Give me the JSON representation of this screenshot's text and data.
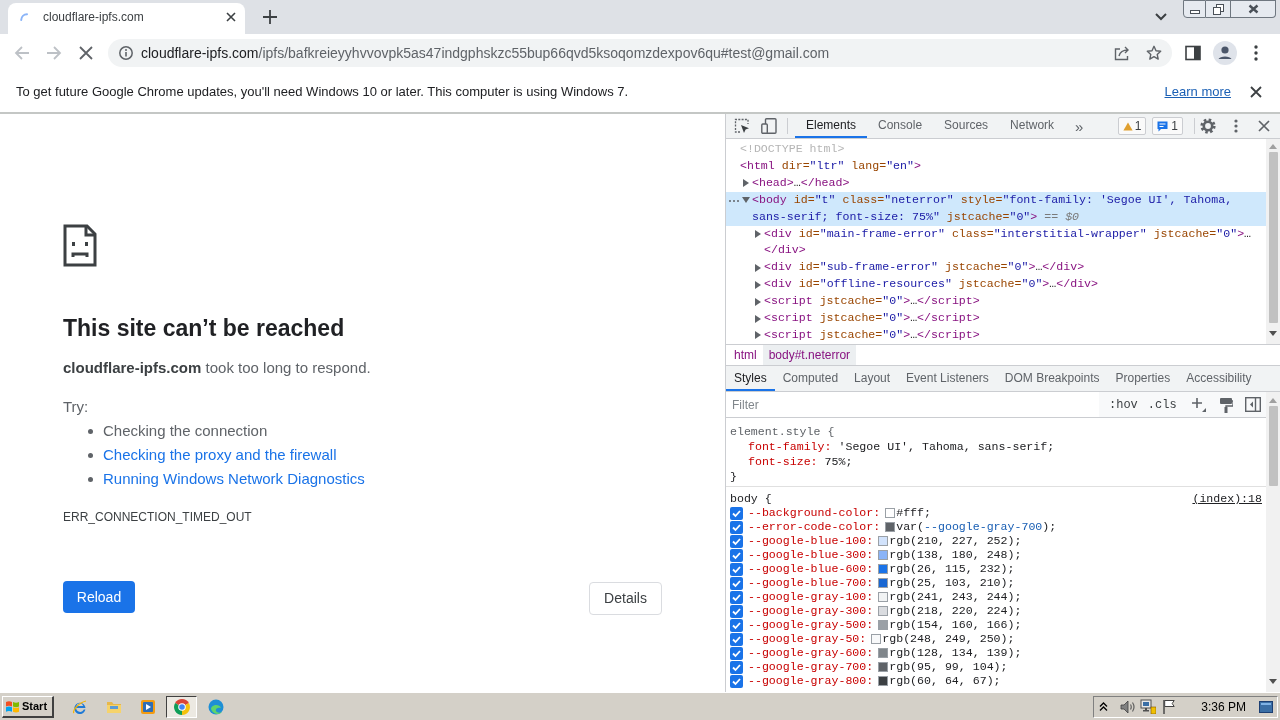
{
  "browser_tabs": [
    {
      "title": "cloudflare-ipfs.com",
      "selected": true,
      "loading": true
    }
  ],
  "toolbar": {
    "nav_buttons": [
      {
        "kind": "back",
        "disabled": true
      },
      {
        "kind": "forward",
        "disabled": true
      }
    ],
    "loading": true,
    "url_host": "cloudflare-ipfs.com",
    "url_path": "/ipfs/bafkreieyyhvvovpk5as47indgphskzc55bup66qvd5ksoqomzdexpov6qu#test@gmail.com"
  },
  "infobar": {
    "message": "To get future Google Chrome updates, you'll need Windows 10 or later. This computer is using Windows 7.",
    "link": "Learn more"
  },
  "error_page": {
    "heading": "This site can’t be reached",
    "summary": "**cloudflare-ipfs.com** took too long to respond.",
    "try_label": "Try:",
    "suggestions": [
      {
        "text": "Checking the connection",
        "kind": "plain"
      },
      {
        "text": "Checking the proxy and the firewall",
        "kind": "link"
      },
      {
        "text": "Running Windows Network Diagnostics",
        "kind": "link"
      }
    ],
    "error_code": "ERR_CONNECTION_TIMED_OUT",
    "buttons": [
      {
        "label": "Reload",
        "kind": "primary"
      },
      {
        "label": "Details",
        "kind": "secondary"
      }
    ]
  },
  "devtools": {
    "tabs": [
      {
        "label": "Elements",
        "selected": true
      },
      {
        "label": "Console",
        "selected": false
      },
      {
        "label": "Sources",
        "selected": false
      },
      {
        "label": "Network",
        "selected": false
      }
    ],
    "more_tabs": "»",
    "warnings": "1",
    "messages": "1",
    "dom_tree": [
      {
        "selected": false,
        "segments": [
          {
            "kind": "doctype",
            "text": "<!DOCTYPE html>"
          }
        ]
      },
      {
        "selected": false,
        "segments": [
          {
            "kind": "tag",
            "text": "<html"
          },
          {
            "kind": "attr",
            "text": " dir="
          },
          {
            "kind": "value",
            "text": "\"ltr\""
          },
          {
            "kind": "attr",
            "text": " lang="
          },
          {
            "kind": "value",
            "text": "\"en\""
          },
          {
            "kind": "tag",
            "text": ">"
          }
        ],
        "children": [
          {
            "expanded": false,
            "selected": false,
            "segments": [
              {
                "kind": "tag",
                "text": "<head>"
              },
              {
                "kind": "text",
                "text": "…"
              },
              {
                "kind": "tag",
                "text": "</head>"
              }
            ]
          },
          {
            "expanded": true,
            "selected": true,
            "segments": [
              {
                "kind": "tag",
                "text": "<body"
              },
              {
                "kind": "attr",
                "text": " id="
              },
              {
                "kind": "value",
                "text": "\"t\""
              },
              {
                "kind": "attr",
                "text": " class="
              },
              {
                "kind": "value",
                "text": "\"neterror\""
              },
              {
                "kind": "attr",
                "text": " style="
              },
              {
                "kind": "value",
                "text": "\"font-family: 'Segoe UI', Tahoma, sans-serif; font-size: 75%\""
              },
              {
                "kind": "attr",
                "text": " jstcache="
              },
              {
                "kind": "value",
                "text": "\"0\""
              },
              {
                "kind": "tag",
                "text": ">"
              },
              {
                "kind": "hint",
                "text": " == *$0*"
              }
            ],
            "children": [
              {
                "expanded": false,
                "selected": false,
                "segments": [
                  {
                    "kind": "tag",
                    "text": "<div"
                  },
                  {
                    "kind": "attr",
                    "text": " id="
                  },
                  {
                    "kind": "value",
                    "text": "\"main-frame-error\""
                  },
                  {
                    "kind": "attr",
                    "text": " class="
                  },
                  {
                    "kind": "value",
                    "text": "\"interstitial-wrapper\""
                  },
                  {
                    "kind": "attr",
                    "text": " jstcache="
                  },
                  {
                    "kind": "value",
                    "text": "\"0\""
                  },
                  {
                    "kind": "tag",
                    "text": ">"
                  },
                  {
                    "kind": "text",
                    "text": "…"
                  },
                  {
                    "kind": "tag",
                    "text": "</div>"
                  }
                ]
              },
              {
                "expanded": false,
                "selected": false,
                "segments": [
                  {
                    "kind": "tag",
                    "text": "<div"
                  },
                  {
                    "kind": "attr",
                    "text": " id="
                  },
                  {
                    "kind": "value",
                    "text": "\"sub-frame-error\""
                  },
                  {
                    "kind": "attr",
                    "text": " jstcache="
                  },
                  {
                    "kind": "value",
                    "text": "\"0\""
                  },
                  {
                    "kind": "tag",
                    "text": ">"
                  },
                  {
                    "kind": "text",
                    "text": "…"
                  },
                  {
                    "kind": "tag",
                    "text": "</div>"
                  }
                ]
              },
              {
                "expanded": false,
                "selected": false,
                "segments": [
                  {
                    "kind": "tag",
                    "text": "<div"
                  },
                  {
                    "kind": "attr",
                    "text": " id="
                  },
                  {
                    "kind": "value",
                    "text": "\"offline-resources\""
                  },
                  {
                    "kind": "attr",
                    "text": " jstcache="
                  },
                  {
                    "kind": "value",
                    "text": "\"0\""
                  },
                  {
                    "kind": "tag",
                    "text": ">"
                  },
                  {
                    "kind": "text",
                    "text": "…"
                  },
                  {
                    "kind": "tag",
                    "text": "</div>"
                  }
                ]
              },
              {
                "expanded": false,
                "selected": false,
                "segments": [
                  {
                    "kind": "tag",
                    "text": "<script"
                  },
                  {
                    "kind": "attr",
                    "text": " jstcache="
                  },
                  {
                    "kind": "value",
                    "text": "\"0\""
                  },
                  {
                    "kind": "tag",
                    "text": ">"
                  },
                  {
                    "kind": "text",
                    "text": "…"
                  },
                  {
                    "kind": "tag",
                    "text": "</script>"
                  }
                ]
              },
              {
                "expanded": false,
                "selected": false,
                "segments": [
                  {
                    "kind": "tag",
                    "text": "<script"
                  },
                  {
                    "kind": "attr",
                    "text": " jstcache="
                  },
                  {
                    "kind": "value",
                    "text": "\"0\""
                  },
                  {
                    "kind": "tag",
                    "text": ">"
                  },
                  {
                    "kind": "text",
                    "text": "…"
                  },
                  {
                    "kind": "tag",
                    "text": "</script>"
                  }
                ]
              },
              {
                "expanded": false,
                "selected": false,
                "segments": [
                  {
                    "kind": "tag",
                    "text": "<script"
                  },
                  {
                    "kind": "attr",
                    "text": " jstcache="
                  },
                  {
                    "kind": "value",
                    "text": "\"0\""
                  },
                  {
                    "kind": "tag",
                    "text": ">"
                  },
                  {
                    "kind": "text",
                    "text": "…"
                  },
                  {
                    "kind": "tag",
                    "text": "</script>"
                  }
                ]
              }
            ]
          }
        ]
      }
    ],
    "breadcrumbs": [
      {
        "label": "html",
        "selected": false
      },
      {
        "label": "body#t.neterror",
        "selected": true
      }
    ],
    "styles_tabs": [
      {
        "label": "Styles",
        "selected": true
      },
      {
        "label": "Computed",
        "selected": false
      },
      {
        "label": "Layout",
        "selected": false
      },
      {
        "label": "Event Listeners",
        "selected": false
      },
      {
        "label": "DOM Breakpoints",
        "selected": false
      },
      {
        "label": "Properties",
        "selected": false
      },
      {
        "label": "Accessibility",
        "selected": false
      }
    ],
    "filter": {
      "placeholder": "Filter"
    },
    "style_toggles": [
      ":hov",
      ".cls"
    ],
    "rules": [
      {
        "selector": "element.style {",
        "closing": "}",
        "declarations": [
          {
            "property": "font-family:",
            "value": "'Segoe UI', Tahoma, sans-serif;"
          },
          {
            "property": "font-size:",
            "value": "75%;"
          }
        ]
      },
      {
        "selector": "body {",
        "source": "(index):18",
        "declarations": [
          {
            "property": "--background-color:",
            "checked": true,
            "color": "#ffffff",
            "value": "#fff;"
          },
          {
            "property": "--error-code-color:",
            "checked": true,
            "color": "#5f6368",
            "value": "var(",
            "link": "--google-gray-700",
            "value_end": ");"
          },
          {
            "property": "--google-blue-100:",
            "checked": true,
            "color": "#d2e3fc",
            "value": "rgb(210, 227, 252);"
          },
          {
            "property": "--google-blue-300:",
            "checked": true,
            "color": "#8ab4f8",
            "value": "rgb(138, 180, 248);"
          },
          {
            "property": "--google-blue-600:",
            "checked": true,
            "color": "#1a73e8",
            "value": "rgb(26, 115, 232);"
          },
          {
            "property": "--google-blue-700:",
            "checked": true,
            "color": "#1967d2",
            "value": "rgb(25, 103, 210);"
          },
          {
            "property": "--google-gray-100:",
            "checked": true,
            "color": "#f1f3f4",
            "value": "rgb(241, 243, 244);"
          },
          {
            "property": "--google-gray-300:",
            "checked": true,
            "color": "#dadce0",
            "value": "rgb(218, 220, 224);"
          },
          {
            "property": "--google-gray-500:",
            "checked": true,
            "color": "#9aa0a6",
            "value": "rgb(154, 160, 166);"
          },
          {
            "property": "--google-gray-50:",
            "checked": true,
            "color": "#f8f9fa",
            "value": "rgb(248, 249, 250);"
          },
          {
            "property": "--google-gray-600:",
            "checked": true,
            "color": "#80868b",
            "value": "rgb(128, 134, 139);"
          },
          {
            "property": "--google-gray-700:",
            "checked": true,
            "color": "#5f6368",
            "value": "rgb(95, 99, 104);"
          },
          {
            "property": "--google-gray-800:",
            "checked": true,
            "color": "#3c4043",
            "value": "rgb(60, 64, 67);"
          }
        ]
      }
    ]
  },
  "taskbar": {
    "start": "Start",
    "apps": [
      {
        "kind": "ie",
        "selected": false
      },
      {
        "kind": "folder",
        "selected": false
      },
      {
        "kind": "media",
        "selected": false
      },
      {
        "kind": "chrome",
        "selected": true
      },
      {
        "kind": "edge",
        "selected": false
      }
    ],
    "clock": "3:36 PM"
  }
}
